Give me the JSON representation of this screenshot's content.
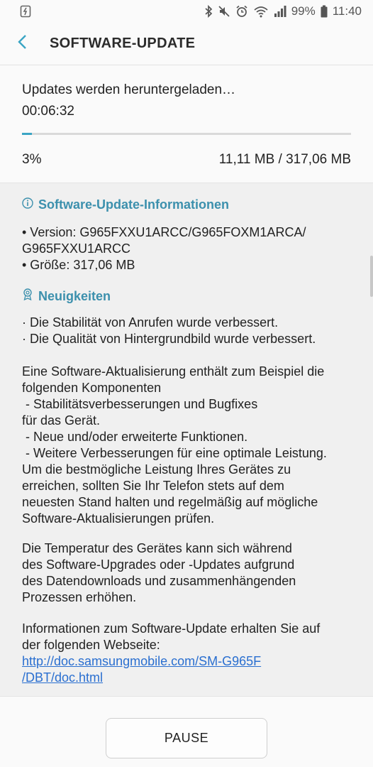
{
  "status_bar": {
    "battery_percent": "99%",
    "time": "11:40",
    "icons": [
      "download-notification-icon",
      "bluetooth-icon",
      "mute-icon",
      "alarm-icon",
      "wifi-icon",
      "signal-icon",
      "battery-icon"
    ]
  },
  "header": {
    "title": "SOFTWARE-UPDATE"
  },
  "download": {
    "status": "Updates werden heruntergeladen…",
    "elapsed": "00:06:32",
    "progress": 0.03,
    "percent": "3%",
    "size": "11,11 MB / 317,06 MB"
  },
  "info_section": {
    "title": "Software-Update-Informationen",
    "version_line1": "• Version: G965FXXU1ARCC/G965FOXM1ARCA/",
    "version_line2": "G965FXXU1ARCC",
    "size_line": "• Größe: 317,06 MB"
  },
  "news_section": {
    "title": "Neuigkeiten",
    "line1": "· Die Stabilität von Anrufen wurde verbessert.",
    "line2": "· Die Qualität von Hintergrundbild wurde verbessert."
  },
  "description": {
    "p1": [
      "Eine Software-Aktualisierung enthält zum Beispiel die",
      "folgenden Komponenten",
      " - Stabilitätsverbesserungen und Bugfixes",
      "für das Gerät.",
      " - Neue und/oder erweiterte Funktionen.",
      " - Weitere Verbesserungen für eine optimale Leistung.",
      "Um die bestmögliche Leistung Ihres Gerätes zu",
      "erreichen, sollten Sie Ihr Telefon stets auf dem",
      "neuesten Stand halten und regelmäßig auf mögliche",
      "Software-Aktualisierungen prüfen."
    ],
    "p2": [
      "Die Temperatur des Gerätes kann sich während",
      "des Software-Upgrades oder -Updates aufgrund",
      "des Datendownloads und zusammenhängenden",
      "Prozessen erhöhen."
    ],
    "p3": [
      "Informationen zum Software-Update erhalten Sie auf",
      "der folgenden Webseite:"
    ],
    "link_line1": "http://doc.samsungmobile.com/SM-G965F",
    "link_line2": "/DBT/doc.html"
  },
  "buttons": {
    "pause": "PAUSE"
  },
  "colors": {
    "accent": "#3aa5c4",
    "section_header": "#3c90ad",
    "link": "#2a6fd0"
  }
}
